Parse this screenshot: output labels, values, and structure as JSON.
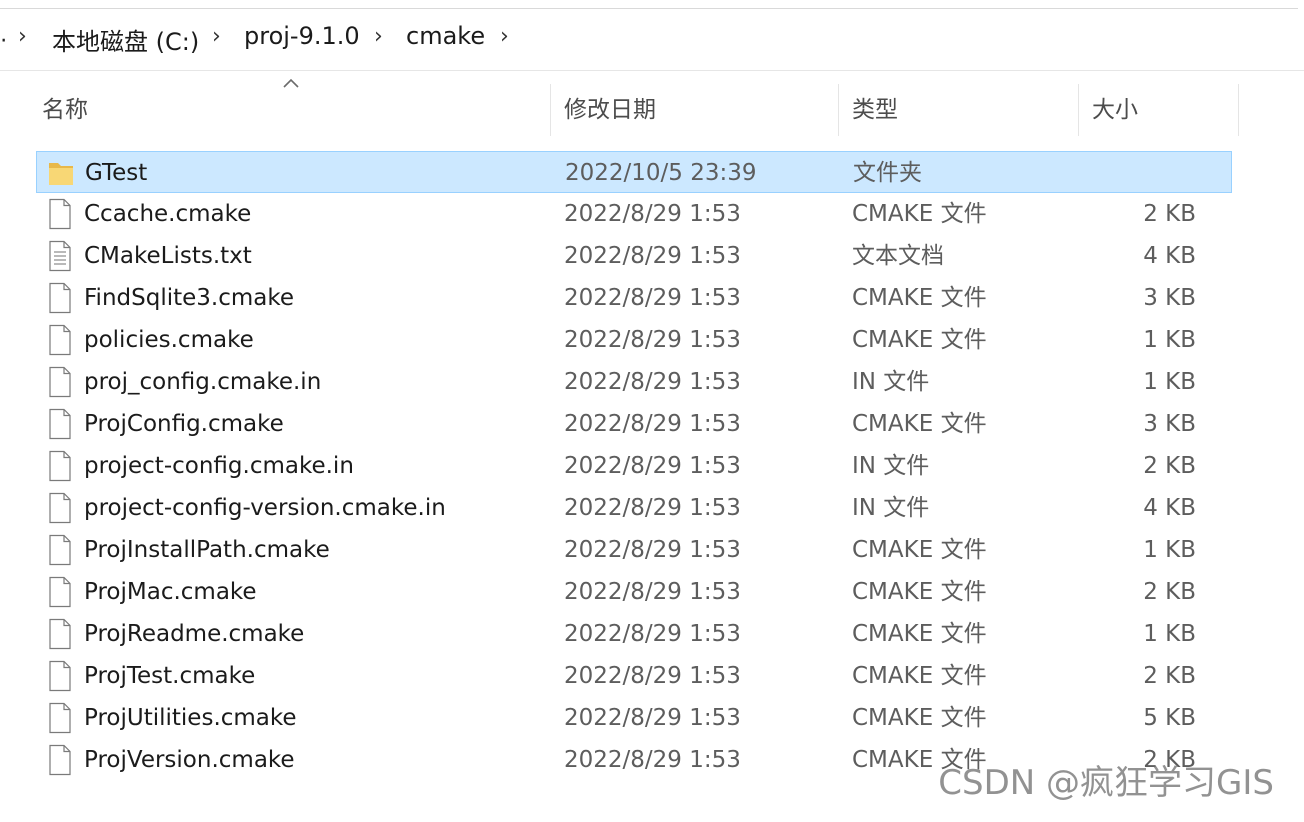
{
  "breadcrumb": {
    "items": [
      "本地磁盘 (C:)",
      "proj-9.1.0",
      "cmake"
    ]
  },
  "columns": {
    "name": "名称",
    "date": "修改日期",
    "type": "类型",
    "size": "大小"
  },
  "files": [
    {
      "name": "GTest",
      "date": "2022/10/5 23:39",
      "type": "文件夹",
      "size": "",
      "kind": "folder",
      "selected": true
    },
    {
      "name": "Ccache.cmake",
      "date": "2022/8/29 1:53",
      "type": "CMAKE 文件",
      "size": "2 KB",
      "kind": "file"
    },
    {
      "name": "CMakeLists.txt",
      "date": "2022/8/29 1:53",
      "type": "文本文档",
      "size": "4 KB",
      "kind": "text"
    },
    {
      "name": "FindSqlite3.cmake",
      "date": "2022/8/29 1:53",
      "type": "CMAKE 文件",
      "size": "3 KB",
      "kind": "file"
    },
    {
      "name": "policies.cmake",
      "date": "2022/8/29 1:53",
      "type": "CMAKE 文件",
      "size": "1 KB",
      "kind": "file"
    },
    {
      "name": "proj_config.cmake.in",
      "date": "2022/8/29 1:53",
      "type": "IN 文件",
      "size": "1 KB",
      "kind": "file"
    },
    {
      "name": "ProjConfig.cmake",
      "date": "2022/8/29 1:53",
      "type": "CMAKE 文件",
      "size": "3 KB",
      "kind": "file"
    },
    {
      "name": "project-config.cmake.in",
      "date": "2022/8/29 1:53",
      "type": "IN 文件",
      "size": "2 KB",
      "kind": "file"
    },
    {
      "name": "project-config-version.cmake.in",
      "date": "2022/8/29 1:53",
      "type": "IN 文件",
      "size": "4 KB",
      "kind": "file"
    },
    {
      "name": "ProjInstallPath.cmake",
      "date": "2022/8/29 1:53",
      "type": "CMAKE 文件",
      "size": "1 KB",
      "kind": "file"
    },
    {
      "name": "ProjMac.cmake",
      "date": "2022/8/29 1:53",
      "type": "CMAKE 文件",
      "size": "2 KB",
      "kind": "file"
    },
    {
      "name": "ProjReadme.cmake",
      "date": "2022/8/29 1:53",
      "type": "CMAKE 文件",
      "size": "1 KB",
      "kind": "file"
    },
    {
      "name": "ProjTest.cmake",
      "date": "2022/8/29 1:53",
      "type": "CMAKE 文件",
      "size": "2 KB",
      "kind": "file"
    },
    {
      "name": "ProjUtilities.cmake",
      "date": "2022/8/29 1:53",
      "type": "CMAKE 文件",
      "size": "5 KB",
      "kind": "file"
    },
    {
      "name": "ProjVersion.cmake",
      "date": "2022/8/29 1:53",
      "type": "CMAKE 文件",
      "size": "2 KB",
      "kind": "file"
    }
  ],
  "watermark": "CSDN @疯狂学习GIS",
  "colors": {
    "selection_bg": "#cce8ff",
    "selection_border": "#99d1ff",
    "folder": "#f8d775"
  }
}
